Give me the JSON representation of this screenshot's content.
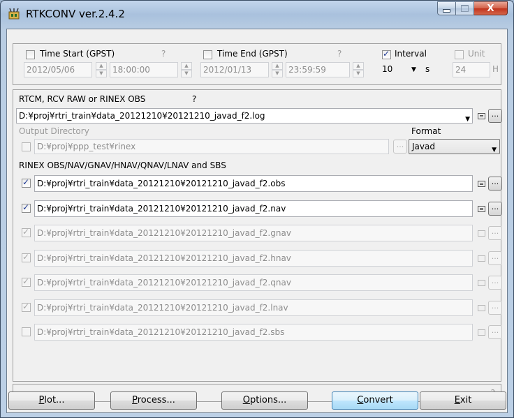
{
  "window": {
    "title": "RTKCONV ver.2.4.2",
    "close_glyph": "X"
  },
  "time_panel": {
    "time_start": {
      "label": "Time Start (GPST)",
      "help": "?",
      "date": "2012/05/06",
      "time": "18:00:00",
      "checked": false
    },
    "time_end": {
      "label": "Time End (GPST)",
      "help": "?",
      "date": "2012/01/13",
      "time": "23:59:59",
      "checked": false
    },
    "interval": {
      "label": "Interval",
      "value": "10",
      "unit": "s",
      "checked": true
    },
    "unit": {
      "label": "Unit",
      "value": "24",
      "suffix": "H",
      "checked": false
    }
  },
  "input": {
    "label": "RTCM, RCV RAW or RINEX OBS",
    "help": "?",
    "path": "D:¥proj¥rtri_train¥data_20121210¥20121210_javad_f2.log"
  },
  "output_dir": {
    "label": "Output Directory",
    "path": "D:¥proj¥ppp_test¥rinex"
  },
  "format": {
    "label": "Format",
    "value": "Javad"
  },
  "rinex": {
    "label": "RINEX OBS/NAV/GNAV/HNAV/QNAV/LNAV and SBS",
    "files": [
      {
        "path": "D:¥proj¥rtri_train¥data_20121210¥20121210_javad_f2.obs",
        "checked": true,
        "enabled": true
      },
      {
        "path": "D:¥proj¥rtri_train¥data_20121210¥20121210_javad_f2.nav",
        "checked": true,
        "enabled": true
      },
      {
        "path": "D:¥proj¥rtri_train¥data_20121210¥20121210_javad_f2.gnav",
        "checked": true,
        "enabled": false
      },
      {
        "path": "D:¥proj¥rtri_train¥data_20121210¥20121210_javad_f2.hnav",
        "checked": true,
        "enabled": false
      },
      {
        "path": "D:¥proj¥rtri_train¥data_20121210¥20121210_javad_f2.qnav",
        "checked": true,
        "enabled": false
      },
      {
        "path": "D:¥proj¥rtri_train¥data_20121210¥20121210_javad_f2.lnav",
        "checked": true,
        "enabled": false
      },
      {
        "path": "D:¥proj¥rtri_train¥data_20121210¥20121210_javad_f2.sbs",
        "checked": false,
        "enabled": false
      }
    ]
  },
  "status": {
    "help": "?"
  },
  "buttons": {
    "plot": {
      "mnemonic": "P",
      "rest": "lot..."
    },
    "process": {
      "mnemonic": "P",
      "rest": "rocess..."
    },
    "options": {
      "mnemonic": "O",
      "rest": "ptions..."
    },
    "convert": {
      "mnemonic": "C",
      "rest": "onvert"
    },
    "exit": {
      "mnemonic": "E",
      "rest": "xit"
    }
  },
  "browse_glyph": "...",
  "spin_up": "▲",
  "spin_down": "▼",
  "dropdown_glyph": "▼"
}
